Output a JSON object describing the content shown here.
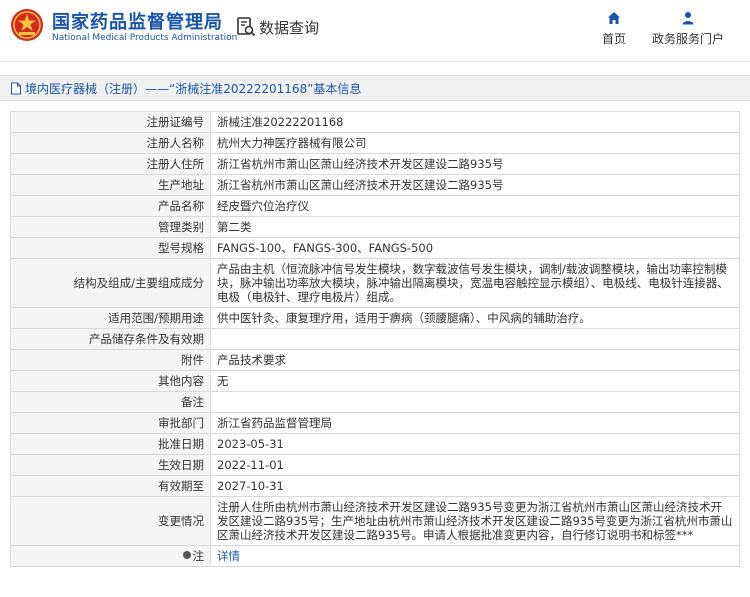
{
  "header": {
    "brand_cn": "国家药品监督管理局",
    "brand_en": "National Medical Products Administration",
    "query_label": "数据查询",
    "nav": [
      {
        "label": "首页",
        "icon": "home-icon"
      },
      {
        "label": "政务服务门户",
        "icon": "user-icon"
      }
    ]
  },
  "breadcrumb": {
    "text": "境内医疗器械（注册）——“浙械注准20222201168”基本信息"
  },
  "rows": [
    {
      "key": "注册证编号",
      "value": "浙械注准20222201168"
    },
    {
      "key": "注册人名称",
      "value": "杭州大力神医疗器械有限公司"
    },
    {
      "key": "注册人住所",
      "value": "浙江省杭州市萧山区萧山经济技术开发区建设二路935号"
    },
    {
      "key": "生产地址",
      "value": "浙江省杭州市萧山区萧山经济技术开发区建设二路935号"
    },
    {
      "key": "产品名称",
      "value": "经皮暨穴位治疗仪"
    },
    {
      "key": "管理类别",
      "value": "第二类"
    },
    {
      "key": "型号规格",
      "value": "FANGS-100、FANGS-300、FANGS-500"
    },
    {
      "key": "结构及组成/主要组成成分",
      "value": "产品由主机（恒流脉冲信号发生模块，数字载波信号发生模块，调制/载波调整模块，输出功率控制模块，脉冲输出功率放大模块，脉冲输出隔离模块，宽温电容触控显示模组）、电极线、电极针连接器、电极（电极针、理疗电极片）组成。"
    },
    {
      "key": "适用范围/预期用途",
      "value": "供中医针灸、康复理疗用，适用于痹病（颈腰腿痛）、中风病的辅助治疗。"
    },
    {
      "key": "产品储存条件及有效期",
      "value": ""
    },
    {
      "key": "附件",
      "value": "产品技术要求"
    },
    {
      "key": "其他内容",
      "value": "无"
    },
    {
      "key": "备注",
      "value": ""
    },
    {
      "key": "审批部门",
      "value": "浙江省药品监督管理局"
    },
    {
      "key": "批准日期",
      "value": "2023-05-31"
    },
    {
      "key": "生效日期",
      "value": "2022-11-01"
    },
    {
      "key": "有效期至",
      "value": "2027-10-31"
    },
    {
      "key": "变更情况",
      "value": "注册人住所由杭州市萧山经济技术开发区建设二路935号变更为浙江省杭州市萧山区萧山经济技术开发区建设二路935号；生产地址由杭州市萧山经济技术开发区建设二路935号变更为浙江省杭州市萧山区萧山经济技术开发区建设二路935号。申请人根据批准变更内容，自行修订说明书和标签***"
    },
    {
      "key": "注",
      "value": "详情"
    }
  ]
}
